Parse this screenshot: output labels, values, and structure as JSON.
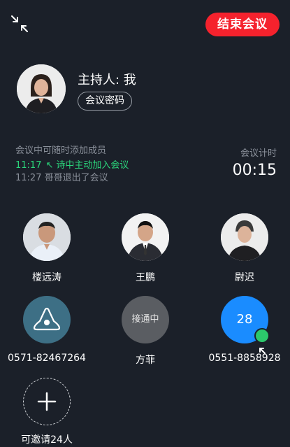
{
  "header": {
    "minimize_icon": "minimize-icon",
    "end_meeting_label": "结束会议"
  },
  "host": {
    "label": "主持人: 我",
    "password_button": "会议密码"
  },
  "activity": {
    "hint": "会议中可随时添加成员",
    "log": [
      {
        "time": "11:17",
        "text": "诗中主动加入会议",
        "color": "#2bd67b"
      },
      {
        "time": "11:27",
        "text": "哥哥退出了会议",
        "color": "#8b919b"
      }
    ]
  },
  "timer": {
    "label": "会议计时",
    "value": "00:15"
  },
  "members": [
    {
      "name": "楼远涛",
      "type": "photo"
    },
    {
      "name": "王鹏",
      "type": "photo"
    },
    {
      "name": "尉迟",
      "type": "photo"
    },
    {
      "name": "0571-82467264",
      "type": "conference-phone"
    },
    {
      "name": "方菲",
      "type": "connecting",
      "status": "接通中"
    },
    {
      "name": "0551-8858928",
      "type": "number",
      "avatar_text": "28",
      "badge": "joined-arrow-icon"
    }
  ],
  "invite": {
    "label": "可邀请24人"
  },
  "colors": {
    "background": "#1b2029",
    "end_button": "#f5222d",
    "accent_green": "#2bd67b",
    "number_avatar": "#1a8cff"
  }
}
